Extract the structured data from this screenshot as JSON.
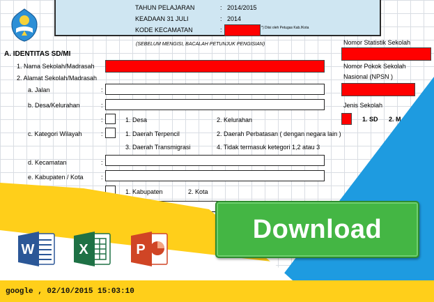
{
  "header": {
    "tahun_label": "TAHUN PELAJARAN",
    "tahun_value": "2014/2015",
    "keadaan_label": "KEADAAN 31 JULI",
    "keadaan_value": "2014",
    "kode_label": "KODE KECAMATAN",
    "kode_note": "*) Diisi oleh Petugas Kab./Kota",
    "colon": ":"
  },
  "instruction": "(SEBELUM MENGISI, BACALAH PETUNJUK PENGISIAN)",
  "section": {
    "title": "A.  IDENTITAS SD/MI",
    "nss_label": "Nomor Statistik Sekolah",
    "npsn_label_1": "Nomor Pokok Sekolah",
    "npsn_label_2": "Nasional      (NPSN )",
    "jenis_label": "Jenis Sekolah",
    "jenis_opt1": "1.  SD",
    "jenis_opt2": "2.  M"
  },
  "rows": {
    "r1": "1.  Nama Sekolah/Madrasah",
    "r2": "2.  Alamat Sekolah/Madrasah",
    "a": "a.  Jalan",
    "b": "b.  Desa/Kelurahan",
    "c": "c.  Kategori Wilayah",
    "d": "d.  Kecamatan",
    "e": "e.  Kabupaten / Kota"
  },
  "options": {
    "desa": "1.  Desa",
    "kelurahan": "2.  Kelurahan",
    "terpencil": "1.  Daerah Terpencil",
    "perbatasan": "2.  Daerah Perbatasan  ( dengan negara lain )",
    "transmigrasi": "3.  Daerah Transmigrasi",
    "tidak": "4.  Tidak termasuk ketegori 1,2 atau 3",
    "kabupaten": "1.  Kabupaten",
    "kota": "2.  Kota"
  },
  "download_label": "Download",
  "footer": "google  ,  02/10/2015 15:03:10",
  "icons": [
    "word-icon",
    "excel-icon",
    "powerpoint-icon"
  ],
  "colors": {
    "yellow": "#ffcf1a",
    "blue": "#1e9be0",
    "green": "#44b644",
    "red": "#ff0000"
  }
}
